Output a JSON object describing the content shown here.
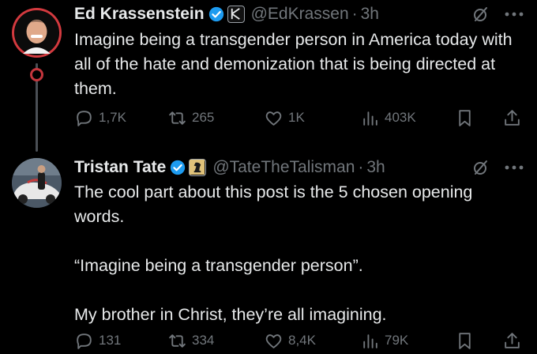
{
  "tweets": [
    {
      "author": {
        "name": "Ed Krassenstein",
        "handle": "@EdKrassen",
        "time": "3h",
        "separator": "·",
        "affiliation_icon": "k-brand-icon"
      },
      "text": [
        "Imagine being a transgender person in America today with all of the hate and demonization that is being directed at them."
      ],
      "stats": {
        "replies": "1,7K",
        "reposts": "265",
        "likes": "1K",
        "views": "403K"
      }
    },
    {
      "author": {
        "name": "Tristan Tate",
        "handle": "@TateTheTalisman",
        "time": "3h",
        "separator": "·",
        "affiliation_icon": "chess-knight-icon"
      },
      "text": [
        "The cool part about this post is the 5 chosen opening words.",
        "“Imagine being a transgender person”.",
        "My brother in Christ, they’re all imagining."
      ],
      "stats": {
        "replies": "131",
        "reposts": "334",
        "likes": "8,4K",
        "views": "79K"
      }
    }
  ],
  "colors": {
    "background": "#000000",
    "text": "#e7e9ea",
    "muted": "#71767b",
    "verified": "#1d9bf0",
    "thread_line": "#4a4f55"
  },
  "icons": [
    "verified-badge-icon",
    "grok-icon",
    "more-icon",
    "reply-icon",
    "repost-icon",
    "like-icon",
    "views-icon",
    "bookmark-icon",
    "share-icon"
  ]
}
